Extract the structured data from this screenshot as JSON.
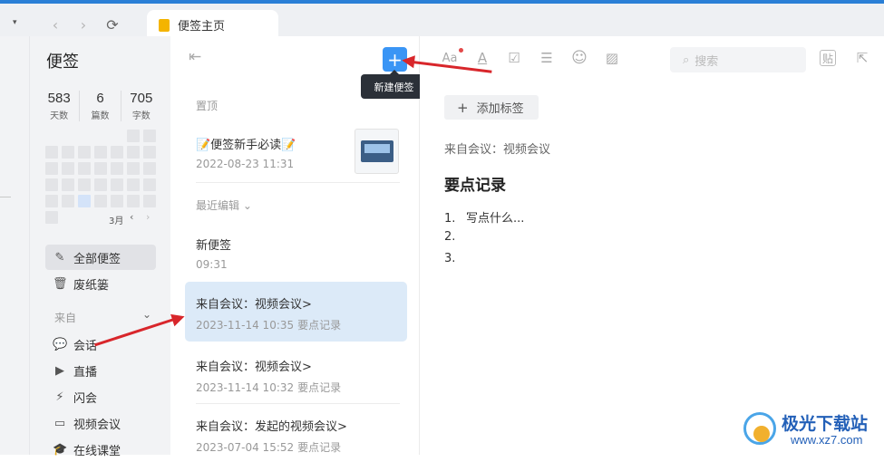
{
  "browser": {
    "dropdown_icon": "▾",
    "back_icon": "‹",
    "forward_icon": "›",
    "refresh_icon": "⟳",
    "tab_label": "便签主页"
  },
  "sidebar": {
    "title": "便签",
    "stats": [
      {
        "value": "583",
        "label": "天数"
      },
      {
        "value": "6",
        "label": "篇数"
      },
      {
        "value": "705",
        "label": "字数"
      }
    ],
    "calendar": {
      "month": "3月",
      "prev": "‹",
      "next": "›"
    },
    "menu": [
      {
        "icon": "✎",
        "label": "全部便签"
      },
      {
        "icon": "🗑",
        "label": "废纸篓"
      }
    ],
    "section_label": "来自",
    "section_chevron": "⌄",
    "sources": [
      {
        "icon": "💬",
        "label": "会话"
      },
      {
        "icon": "▶",
        "label": "直播"
      },
      {
        "icon": "⚡",
        "label": "闪会"
      },
      {
        "icon": "▭",
        "label": "视频会议"
      },
      {
        "icon": "🎓",
        "label": "在线课堂"
      }
    ]
  },
  "list": {
    "collapse_icon": "⇤",
    "add_icon": "+",
    "tooltip": "新建便签",
    "pinned_label": "置顶",
    "pinned_note": {
      "title": "📝便签新手必读📝",
      "time": "2022-08-23 11:31"
    },
    "recent_label": "最近编辑 ⌄",
    "notes": [
      {
        "title": "新便签",
        "time": "09:31",
        "tag": ""
      },
      {
        "title": "来自会议：视频会议>",
        "time": "2023-11-14 10:35",
        "tag": "要点记录"
      },
      {
        "title": "来自会议：视频会议>",
        "time": "2023-11-14 10:32",
        "tag": "要点记录"
      },
      {
        "title": "来自会议：发起的视频会议>",
        "time": "2023-07-04 15:52",
        "tag": "要点记录"
      }
    ]
  },
  "editor": {
    "toolbar": {
      "font_size": "Aa",
      "text_color": "A",
      "checkbox": "☑",
      "divider": "☰",
      "emoji": "☺",
      "image": "▨",
      "search_icon": "⌕",
      "search_placeholder": "搜索",
      "paste": "贴",
      "share": "⇱"
    },
    "add_tag": "添加标签",
    "add_tag_icon": "+",
    "source": "来自会议：视频会议",
    "heading": "要点记录",
    "items": [
      {
        "num": "1.",
        "text": "写点什么..."
      },
      {
        "num": "2.",
        "text": ""
      },
      {
        "num": "3.",
        "text": ""
      }
    ]
  },
  "watermark": {
    "title": "极光下载站",
    "url": "www.xz7.com"
  },
  "colors": {
    "accent": "#3a95f5",
    "selection": "#dceaf8",
    "arrow": "#d8262b"
  }
}
